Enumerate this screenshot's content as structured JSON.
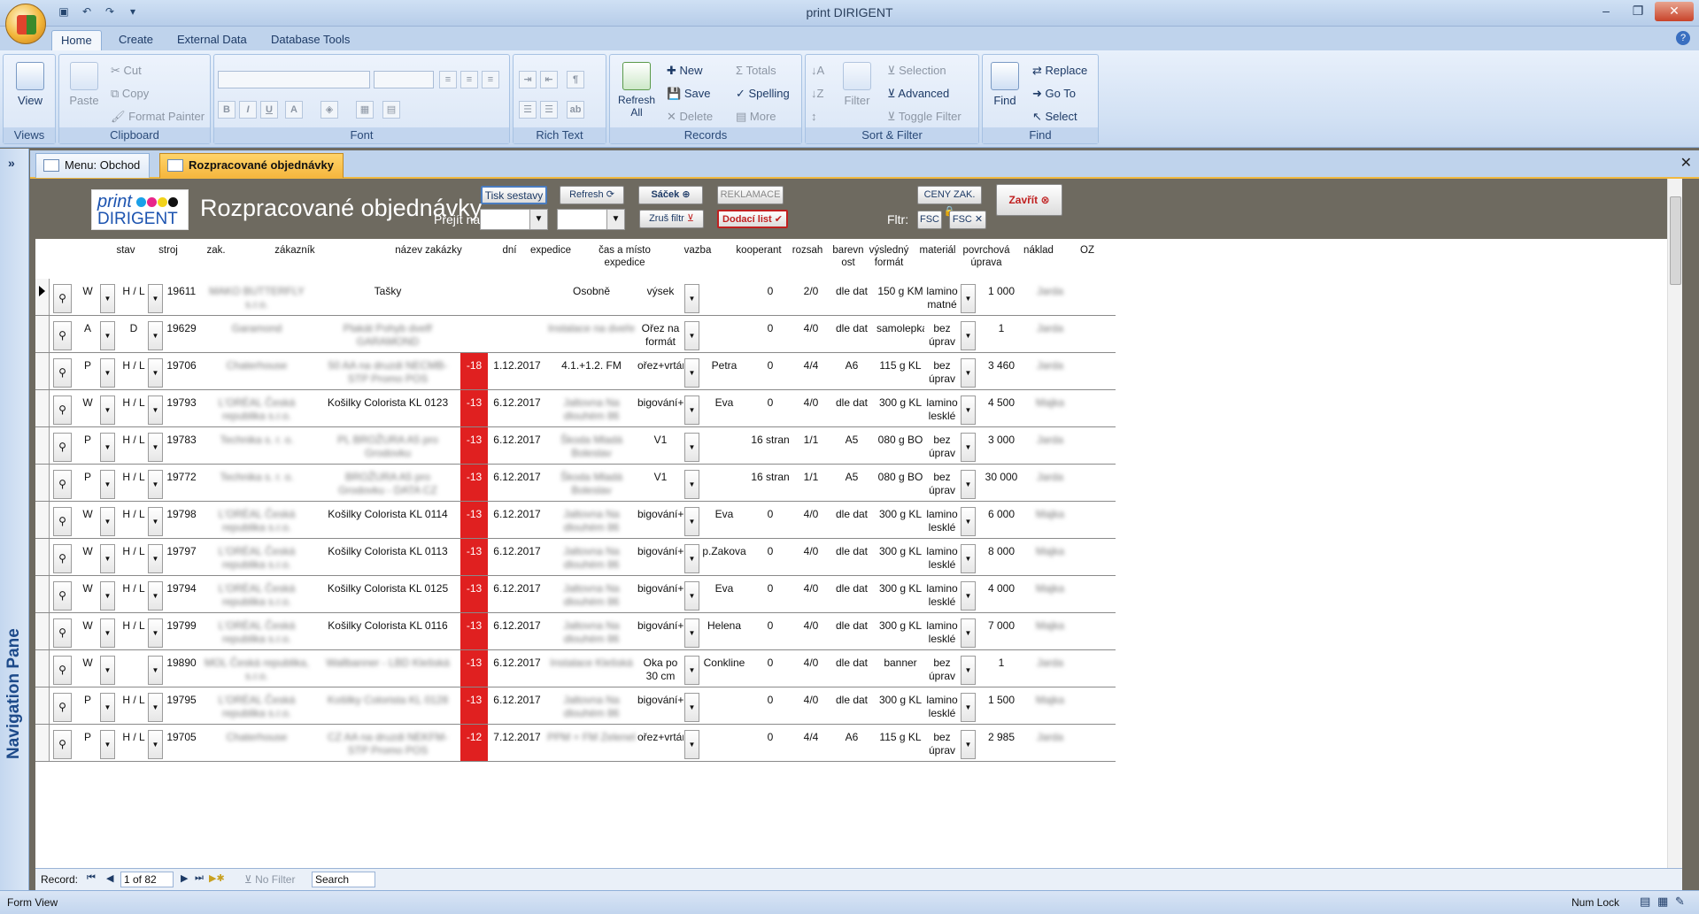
{
  "app": {
    "title": "print DIRIGENT"
  },
  "ribbon": {
    "tabs": [
      "Home",
      "Create",
      "External Data",
      "Database Tools"
    ],
    "groups": {
      "views": {
        "label": "Views",
        "view": "View"
      },
      "clipboard": {
        "label": "Clipboard",
        "paste": "Paste",
        "cut": "Cut",
        "copy": "Copy",
        "format_painter": "Format Painter"
      },
      "font": {
        "label": "Font"
      },
      "rich_text": {
        "label": "Rich Text"
      },
      "records": {
        "label": "Records",
        "refresh": "Refresh All",
        "new": "New",
        "save": "Save",
        "delete": "Delete",
        "totals": "Totals",
        "spelling": "Spelling",
        "more": "More"
      },
      "sort_filter": {
        "label": "Sort & Filter",
        "filter": "Filter",
        "selection": "Selection",
        "advanced": "Advanced",
        "toggle": "Toggle Filter"
      },
      "find": {
        "label": "Find",
        "find": "Find",
        "replace": "Replace",
        "goto": "Go To",
        "select": "Select"
      }
    }
  },
  "nav": {
    "label": "Navigation Pane",
    "chevron": "»"
  },
  "doc_tabs": [
    "Menu: Obchod",
    "Rozpracované objednávky"
  ],
  "form": {
    "logo_line1": "print",
    "logo_line2": "DIRIGENT",
    "title": "Rozpracované objednávky",
    "buttons": {
      "tisk": "Tisk sestavy",
      "refresh": "Refresh",
      "sacek": "Sáček",
      "reklamace": "REKLAMACE",
      "ceny": "CENY ZAK.",
      "zavrit": "Zavřít",
      "zrus": "Zruš filtr",
      "dodaci": "Dodací list",
      "fsc1": "FSC",
      "fsc2": "FSC"
    },
    "goto_label": "Přejít na:",
    "filter_label": "Fltr:",
    "columns": [
      "stav",
      "stroj",
      "zak.",
      "zákazník",
      "název zakázky",
      "dní",
      "expedice",
      "čas a místo expedice",
      "vazba",
      "kooperant",
      "rozsah",
      "barevn ost",
      "výsledný formát",
      "materiál",
      "povrchová úprava",
      "náklad",
      "OZ"
    ]
  },
  "rows": [
    {
      "stav": "W",
      "stroj": "H / L",
      "zak": "19611",
      "zakaznik": "MAKO BUTTERFLY s.r.o.",
      "nazev": "Tašky",
      "nazev_blur": false,
      "dni": "",
      "expedice": "",
      "cas": "Osobně",
      "cas_blur": false,
      "vazba": "výsek",
      "kooperant": "",
      "rozsah": "0",
      "barev": "2/0",
      "format": "dle dat",
      "material": "150 g KM",
      "uprava": "lamino matné",
      "naklad": "1 000",
      "oz": "Jarda"
    },
    {
      "stav": "A",
      "stroj": "D",
      "zak": "19629",
      "zakaznik": "Garamond",
      "nazev": "Plakát Pohyb dvefř GARAMOND",
      "nazev_blur": true,
      "dni": "",
      "expedice": "",
      "cas": "Instalace na dveře",
      "cas_blur": true,
      "vazba": "Ořez na formát",
      "kooperant": "",
      "rozsah": "0",
      "barev": "4/0",
      "format": "dle dat",
      "material": "samolepka",
      "uprava": "bez úprav",
      "naklad": "1",
      "oz": "Jarda"
    },
    {
      "stav": "P",
      "stroj": "H / L",
      "zak": "19706",
      "zakaznik": "Chaterhouse",
      "nazev": "50 AA na druzdi NECMB-STP Promo POS",
      "nazev_blur": true,
      "dni": "-18",
      "expedice": "1.12.2017",
      "cas": "4.1.+1.2. FM",
      "cas_blur": false,
      "vazba": "ořez+vrtání+navlék",
      "kooperant": "Petra",
      "rozsah": "0",
      "barev": "4/4",
      "format": "A6",
      "material": "115 g KL",
      "uprava": "bez úprav",
      "naklad": "3 460",
      "oz": "Jarda"
    },
    {
      "stav": "W",
      "stroj": "H / L",
      "zak": "19793",
      "zakaznik": "L'ORÉAL Česká republika s.r.o.",
      "nazev": "Košilky Colorista KL 0123",
      "nazev_blur": false,
      "dni": "-13",
      "expedice": "6.12.2017",
      "cas": "Jaltovna Na dlouhém 86",
      "cas_blur": true,
      "vazba": "bigování+oboustra",
      "kooperant": "Eva",
      "rozsah": "0",
      "barev": "4/0",
      "format": "dle dat",
      "material": "300 g KL",
      "uprava": "lamino lesklé",
      "naklad": "4 500",
      "oz": "Majka"
    },
    {
      "stav": "P",
      "stroj": "H / L",
      "zak": "19783",
      "zakaznik": "Technika s. r. o.",
      "nazev": "PL BROŽURA A5 pro Grodovku",
      "nazev_blur": true,
      "dni": "-13",
      "expedice": "6.12.2017",
      "cas": "Škoda Mladá Boleslav",
      "cas_blur": true,
      "vazba": "V1",
      "kooperant": "",
      "rozsah": "16 stran",
      "barev": "1/1",
      "format": "A5",
      "material": "080 g BO",
      "uprava": "bez úprav",
      "naklad": "3 000",
      "oz": "Jarda"
    },
    {
      "stav": "P",
      "stroj": "H / L",
      "zak": "19772",
      "zakaznik": "Technika s. r. o.",
      "nazev": "BROŽURA A5 pro Grodovku - DATA CZ",
      "nazev_blur": true,
      "dni": "-13",
      "expedice": "6.12.2017",
      "cas": "Škoda Mladá Boleslav",
      "cas_blur": true,
      "vazba": "V1",
      "kooperant": "",
      "rozsah": "16 stran",
      "barev": "1/1",
      "format": "A5",
      "material": "080 g BO",
      "uprava": "bez úprav",
      "naklad": "30 000",
      "oz": "Jarda"
    },
    {
      "stav": "W",
      "stroj": "H / L",
      "zak": "19798",
      "zakaznik": "L'ORÉAL Česká republika s.r.o.",
      "nazev": "Košilky Colorista KL 0114",
      "nazev_blur": false,
      "dni": "-13",
      "expedice": "6.12.2017",
      "cas": "Jaltovna Na dlouhém 86",
      "cas_blur": true,
      "vazba": "bigování+oboustra",
      "kooperant": "Eva",
      "rozsah": "0",
      "barev": "4/0",
      "format": "dle dat",
      "material": "300 g KL",
      "uprava": "lamino lesklé",
      "naklad": "6 000",
      "oz": "Majka"
    },
    {
      "stav": "W",
      "stroj": "H / L",
      "zak": "19797",
      "zakaznik": "L'ORÉAL Česká republika s.r.o.",
      "nazev": "Košilky Colorista KL 0113",
      "nazev_blur": false,
      "dni": "-13",
      "expedice": "6.12.2017",
      "cas": "Jaltovna Na dlouhém 86",
      "cas_blur": true,
      "vazba": "bigování+oboustra",
      "kooperant": "p.Zakova",
      "rozsah": "0",
      "barev": "4/0",
      "format": "dle dat",
      "material": "300 g KL",
      "uprava": "lamino lesklé",
      "naklad": "8 000",
      "oz": "Majka"
    },
    {
      "stav": "W",
      "stroj": "H / L",
      "zak": "19794",
      "zakaznik": "L'ORÉAL Česká republika s.r.o.",
      "nazev": "Košilky Colorista KL 0125",
      "nazev_blur": false,
      "dni": "-13",
      "expedice": "6.12.2017",
      "cas": "Jaltovna Na dlouhém 86",
      "cas_blur": true,
      "vazba": "bigování+oboustra",
      "kooperant": "Eva",
      "rozsah": "0",
      "barev": "4/0",
      "format": "dle dat",
      "material": "300 g KL",
      "uprava": "lamino lesklé",
      "naklad": "4 000",
      "oz": "Majka"
    },
    {
      "stav": "W",
      "stroj": "H / L",
      "zak": "19799",
      "zakaznik": "L'ORÉAL Česká republika s.r.o.",
      "nazev": "Košilky Colorista KL 0116",
      "nazev_blur": false,
      "dni": "-13",
      "expedice": "6.12.2017",
      "cas": "Jaltovna Na dlouhém 86",
      "cas_blur": true,
      "vazba": "bigování+oboustra",
      "kooperant": "Helena",
      "rozsah": "0",
      "barev": "4/0",
      "format": "dle dat",
      "material": "300 g KL",
      "uprava": "lamino lesklé",
      "naklad": "7 000",
      "oz": "Majka"
    },
    {
      "stav": "W",
      "stroj": "",
      "zak": "19890",
      "zakaznik": "MOL Česká republika, s.r.o.",
      "nazev": "Wallbanner - LBD Klešská",
      "nazev_blur": true,
      "dni": "-13",
      "expedice": "6.12.2017",
      "cas": "Instalace Klešská",
      "cas_blur": true,
      "vazba": "Oka po 30 cm",
      "kooperant": "Conkline",
      "rozsah": "0",
      "barev": "4/0",
      "format": "dle dat",
      "material": "banner",
      "uprava": "bez úprav",
      "naklad": "1",
      "oz": "Jarda"
    },
    {
      "stav": "P",
      "stroj": "H / L",
      "zak": "19795",
      "zakaznik": "L'ORÉAL Česká republika s.r.o.",
      "nazev": "Košilky Colorista KL 0128",
      "nazev_blur": true,
      "dni": "-13",
      "expedice": "6.12.2017",
      "cas": "Jaltovna Na dlouhém 86",
      "cas_blur": true,
      "vazba": "bigování+oboustra",
      "kooperant": "",
      "rozsah": "0",
      "barev": "4/0",
      "format": "dle dat",
      "material": "300 g KL",
      "uprava": "lamino lesklé",
      "naklad": "1 500",
      "oz": "Majka"
    },
    {
      "stav": "P",
      "stroj": "H / L",
      "zak": "19705",
      "zakaznik": "Chaterhouse",
      "nazev": "CZ AA na druzdi NEKFM-STP Promo POS",
      "nazev_blur": true,
      "dni": "-12",
      "expedice": "7.12.2017",
      "cas": "PPM + FM Zelenel",
      "cas_blur": true,
      "vazba": "ořez+vrtání+navlék",
      "kooperant": "",
      "rozsah": "0",
      "barev": "4/4",
      "format": "A6",
      "material": "115 g KL",
      "uprava": "bez úprav",
      "naklad": "2 985",
      "oz": "Jarda"
    }
  ],
  "record_nav": {
    "label": "Record:",
    "position": "1 of 82",
    "filter": "No Filter",
    "search": "Search"
  },
  "status": {
    "view": "Form View",
    "numlock": "Num Lock"
  },
  "colors": {
    "accent": "#f5b63e",
    "overdue": "#e02020",
    "header_bg": "#6e6a60"
  }
}
